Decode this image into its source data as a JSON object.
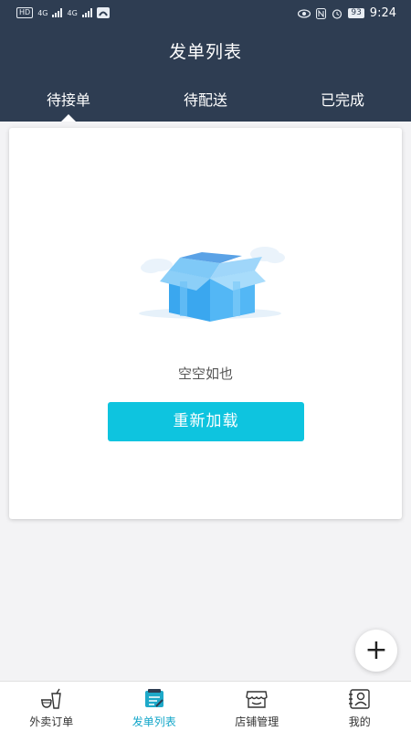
{
  "status_bar": {
    "left_chips": [
      "HD",
      "4G",
      "4G"
    ],
    "battery": "93",
    "time": "9:24"
  },
  "header": {
    "title": "发单列表"
  },
  "tabs": [
    {
      "label": "待接单",
      "active": true
    },
    {
      "label": "待配送",
      "active": false
    },
    {
      "label": "已完成",
      "active": false
    }
  ],
  "empty_state": {
    "icon": "empty-box-icon",
    "text": "空空如也",
    "button_label": "重新加载"
  },
  "fab": {
    "icon": "plus-icon",
    "label": "+"
  },
  "bottom_nav": [
    {
      "label": "外卖订单",
      "icon": "takeout-icon",
      "active": false
    },
    {
      "label": "发单列表",
      "icon": "order-list-icon",
      "active": true
    },
    {
      "label": "店铺管理",
      "icon": "store-icon",
      "active": false
    },
    {
      "label": "我的",
      "icon": "profile-icon",
      "active": false
    }
  ],
  "colors": {
    "header_bg": "#2e3d52",
    "accent": "#0ec4df",
    "active_nav": "#12a6c9",
    "page_bg": "#f3f3f5"
  }
}
